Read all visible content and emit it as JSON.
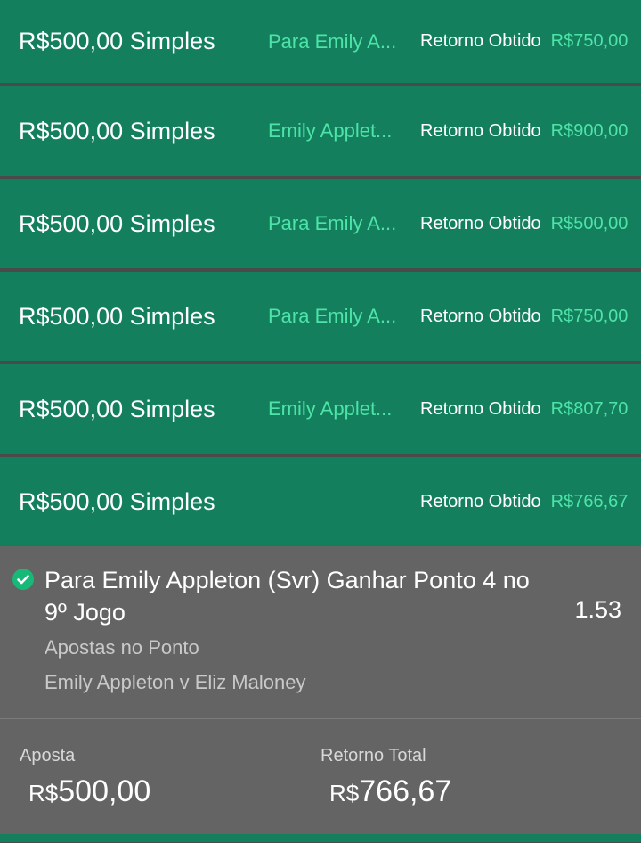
{
  "bets": [
    {
      "title": "R$500,00 Simples",
      "selection": "Para Emily A...",
      "return_label": "Retorno Obtido",
      "return_value": "R$750,00"
    },
    {
      "title": "R$500,00 Simples",
      "selection": "Emily Applet...",
      "return_label": "Retorno Obtido",
      "return_value": "R$900,00"
    },
    {
      "title": "R$500,00 Simples",
      "selection": "Para Emily A...",
      "return_label": "Retorno Obtido",
      "return_value": "R$500,00"
    },
    {
      "title": "R$500,00 Simples",
      "selection": "Para Emily A...",
      "return_label": "Retorno Obtido",
      "return_value": "R$750,00"
    },
    {
      "title": "R$500,00 Simples",
      "selection": "Emily Applet...",
      "return_label": "Retorno Obtido",
      "return_value": "R$807,70"
    },
    {
      "title": "R$500,00 Simples",
      "selection": "",
      "return_label": "Retorno Obtido",
      "return_value": "R$766,67"
    }
  ],
  "detail": {
    "selection_title": "Para Emily Appleton (Svr) Ganhar Ponto 4 no 9º Jogo",
    "odds": "1.53",
    "market": "Apostas no Ponto",
    "event": "Emily Appleton v Eliz Maloney",
    "status_icon": "check-circle-icon"
  },
  "summary": {
    "stake_label": "Aposta",
    "stake_currency": "R$",
    "stake_amount": "500,00",
    "total_label": "Retorno Total",
    "total_currency": "R$",
    "total_amount": "766,67"
  },
  "colors": {
    "row_green": "#137f5c",
    "accent_green": "#4de3a9",
    "panel_gray": "#646464"
  }
}
